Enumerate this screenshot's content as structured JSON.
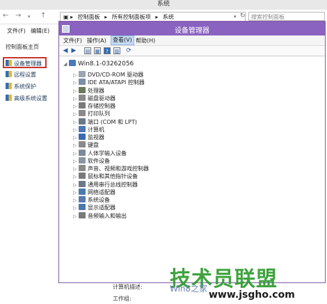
{
  "outer_window": {
    "title": "系统",
    "address_path": [
      "控制面板",
      "所有控制面板项",
      "系统"
    ],
    "search_placeholder": "搜索控制面板",
    "menu": [
      "文件(F)",
      "编辑(E)"
    ],
    "sidebar_home": "控制面板主页",
    "sidebar_items": [
      "设备管理器",
      "远程设置",
      "系统保护",
      "高级系统设置"
    ],
    "bottom_labels": [
      "计算机描述:",
      "工作组:"
    ]
  },
  "device_manager": {
    "title": "设备管理器",
    "menu": [
      "文件(F)",
      "操作(A)",
      "查看(V)",
      "帮助(H)"
    ],
    "active_menu": "查看(V)",
    "root": "Win8.1-03262056",
    "devices": [
      {
        "label": "DVD/CD-ROM 驱动器",
        "icon": "dvd-drive-icon",
        "color": "#9aa6b4"
      },
      {
        "label": "IDE ATA/ATAPI 控制器",
        "icon": "ide-controller-icon",
        "color": "#7d8fa8"
      },
      {
        "label": "处理器",
        "icon": "processor-icon",
        "color": "#6a7a5a"
      },
      {
        "label": "磁盘驱动器",
        "icon": "disk-drive-icon",
        "color": "#8a8a8a"
      },
      {
        "label": "存储控制器",
        "icon": "storage-controller-icon",
        "color": "#7a7a7a"
      },
      {
        "label": "打印队列",
        "icon": "printer-icon",
        "color": "#8a8a8a"
      },
      {
        "label": "端口 (COM 和 LPT)",
        "icon": "port-icon",
        "color": "#6a7888"
      },
      {
        "label": "计算机",
        "icon": "computer-icon",
        "color": "#4a78b8"
      },
      {
        "label": "监视器",
        "icon": "monitor-icon",
        "color": "#3a6ab0"
      },
      {
        "label": "键盘",
        "icon": "keyboard-icon",
        "color": "#8a8a8a"
      },
      {
        "label": "人体学输入设备",
        "icon": "hid-icon",
        "color": "#7a8a9a"
      },
      {
        "label": "软件设备",
        "icon": "software-device-icon",
        "color": "#8a96a4"
      },
      {
        "label": "声音、视频和游戏控制器",
        "icon": "sound-icon",
        "color": "#8a8a8a"
      },
      {
        "label": "鼠标和其他指针设备",
        "icon": "mouse-icon",
        "color": "#7a7a7a"
      },
      {
        "label": "通用串行总线控制器",
        "icon": "usb-icon",
        "color": "#6a7a8a"
      },
      {
        "label": "网络适配器",
        "icon": "network-adapter-icon",
        "color": "#4a7ab0"
      },
      {
        "label": "系统设备",
        "icon": "system-device-icon",
        "color": "#5a7ab0"
      },
      {
        "label": "显示适配器",
        "icon": "display-adapter-icon",
        "color": "#4a78b0"
      },
      {
        "label": "音频输入和输出",
        "icon": "audio-io-icon",
        "color": "#7a7a7a"
      }
    ]
  },
  "watermark": {
    "logo_text": "技术员联盟",
    "os_text": "Win8之家",
    "url": "www.jsgho.com"
  },
  "colors": {
    "title_bar": "#8a62c0",
    "highlight_border": "#c8342c",
    "logo_green": "#2a9a2a"
  }
}
